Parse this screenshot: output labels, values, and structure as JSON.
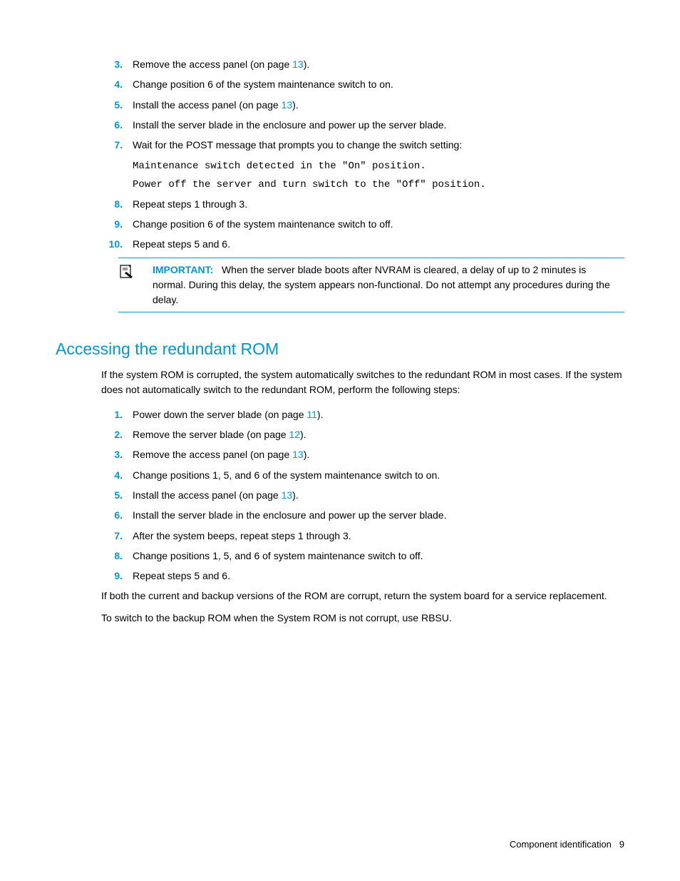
{
  "list1": {
    "items": [
      {
        "num": "3.",
        "pre": "Remove the access panel (on page ",
        "link": "13",
        "post": ")."
      },
      {
        "num": "4.",
        "pre": "Change position 6 of the system maintenance switch to on.",
        "link": "",
        "post": ""
      },
      {
        "num": "5.",
        "pre": "Install the access panel (on page ",
        "link": "13",
        "post": ")."
      },
      {
        "num": "6.",
        "pre": "Install the server blade in the enclosure and power up the server blade.",
        "link": "",
        "post": ""
      },
      {
        "num": "7.",
        "pre": "Wait for the POST message that prompts you to change the switch setting:",
        "link": "",
        "post": ""
      }
    ]
  },
  "code": {
    "line1": "Maintenance switch detected in the \"On\" position.",
    "line2": "Power off the server and turn switch to the \"Off\" position."
  },
  "list2": {
    "items": [
      {
        "num": "8.",
        "pre": "Repeat steps 1 through 3.",
        "link": "",
        "post": ""
      },
      {
        "num": "9.",
        "pre": "Change position 6 of the system maintenance switch to off.",
        "link": "",
        "post": ""
      },
      {
        "num": "10.",
        "pre": "Repeat steps 5 and 6.",
        "link": "",
        "post": ""
      }
    ]
  },
  "important": {
    "label": "IMPORTANT:",
    "text": "When the server blade boots after NVRAM is cleared, a delay of up to 2 minutes is normal. During this delay, the system appears non-functional. Do not attempt any procedures during the delay."
  },
  "heading": "Accessing the redundant ROM",
  "intro": "If the system ROM is corrupted, the system automatically switches to the redundant ROM in most cases. If the system does not automatically switch to the redundant ROM, perform the following steps:",
  "list3": {
    "items": [
      {
        "num": "1.",
        "pre": "Power down the server blade (on page ",
        "link": "11",
        "post": ")."
      },
      {
        "num": "2.",
        "pre": "Remove the server blade (on page ",
        "link": "12",
        "post": ")."
      },
      {
        "num": "3.",
        "pre": "Remove the access panel (on page ",
        "link": "13",
        "post": ")."
      },
      {
        "num": "4.",
        "pre": "Change positions 1, 5, and 6 of the system maintenance switch to on.",
        "link": "",
        "post": ""
      },
      {
        "num": "5.",
        "pre": "Install the access panel (on page ",
        "link": "13",
        "post": ")."
      },
      {
        "num": "6.",
        "pre": "Install the server blade in the enclosure and power up the server blade.",
        "link": "",
        "post": ""
      },
      {
        "num": "7.",
        "pre": "After the system beeps, repeat steps 1 through 3.",
        "link": "",
        "post": ""
      },
      {
        "num": "8.",
        "pre": "Change positions 1, 5, and 6 of system maintenance switch to off.",
        "link": "",
        "post": ""
      },
      {
        "num": "9.",
        "pre": "Repeat steps 5 and 6.",
        "link": "",
        "post": ""
      }
    ]
  },
  "outro1": "If both the current and backup versions of the ROM are corrupt, return the system board for a service replacement.",
  "outro2": "To switch to the backup ROM when the System ROM is not corrupt, use RBSU.",
  "footer": {
    "section": "Component identification",
    "page": "9"
  }
}
